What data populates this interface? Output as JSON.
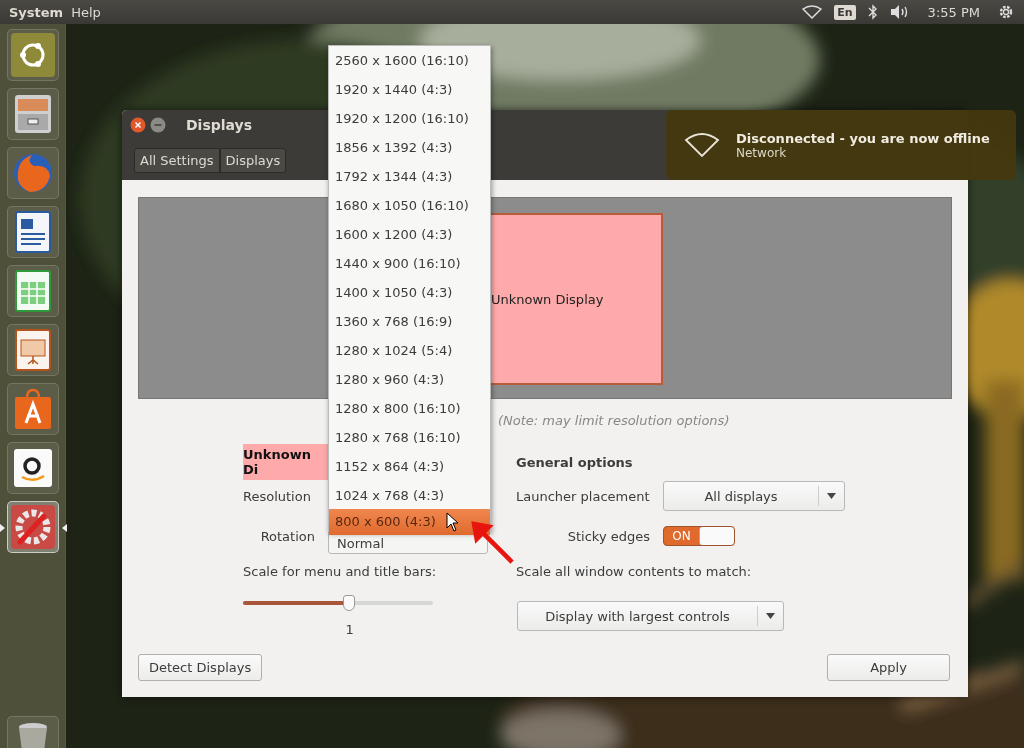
{
  "top_panel": {
    "menus": [
      "System",
      "Help"
    ],
    "keyboard_layout": "En",
    "clock": "3:55 PM"
  },
  "launcher": {
    "items": [
      {
        "kind": "dash",
        "active": false
      },
      {
        "kind": "files",
        "active": false
      },
      {
        "kind": "browser",
        "active": false
      },
      {
        "kind": "writer",
        "active": false
      },
      {
        "kind": "calc",
        "active": false
      },
      {
        "kind": "impress",
        "active": false
      },
      {
        "kind": "store",
        "active": false
      },
      {
        "kind": "amazon",
        "active": false
      },
      {
        "kind": "settings",
        "active": true
      },
      {
        "kind": "trash",
        "active": false
      }
    ]
  },
  "notification": {
    "title": "Disconnected - you are now offline",
    "subtitle": "Network"
  },
  "window": {
    "title": "Displays",
    "breadcrumbs": [
      "All Settings",
      "Displays"
    ],
    "monitor_label": "Unknown Display",
    "note": "(Note: may limit resolution options)",
    "display_name": "Unknown Di",
    "resolution_label": "Resolution",
    "rotation_label": "Rotation",
    "rotation_value": "Normal",
    "scale_label": "Scale for menu and title bars:",
    "scale": {
      "level": 0.56,
      "reading": "1"
    },
    "general": {
      "title": "General options",
      "launcher_label": "Launcher placement",
      "launcher_value": "All displays",
      "sticky_label": "Sticky edges",
      "sticky": {
        "on": true,
        "label": "ON"
      },
      "scale_all_label": "Scale all window contents to match:",
      "scale_all_value": "Display with largest controls"
    },
    "buttons": [
      "Detect Displays",
      "Apply"
    ]
  },
  "resolution_menu": {
    "items": [
      {
        "label": "2560 x 1600 (16:10)",
        "selected": false
      },
      {
        "label": "1920 x 1440 (4:3)",
        "selected": false
      },
      {
        "label": "1920 x 1200 (16:10)",
        "selected": false
      },
      {
        "label": "1856 x 1392 (4:3)",
        "selected": false
      },
      {
        "label": "1792 x 1344 (4:3)",
        "selected": false
      },
      {
        "label": "1680 x 1050 (16:10)",
        "selected": false
      },
      {
        "label": "1600 x 1200 (4:3)",
        "selected": false
      },
      {
        "label": "1440 x 900 (16:10)",
        "selected": false
      },
      {
        "label": "1400 x 1050 (4:3)",
        "selected": false
      },
      {
        "label": "1360 x 768 (16:9)",
        "selected": false
      },
      {
        "label": "1280 x 1024 (5:4)",
        "selected": false
      },
      {
        "label": "1280 x 960 (4:3)",
        "selected": false
      },
      {
        "label": "1280 x 800 (16:10)",
        "selected": false
      },
      {
        "label": "1280 x 768 (16:10)",
        "selected": false
      },
      {
        "label": "1152 x 864 (4:3)",
        "selected": false
      },
      {
        "label": "1024 x 768 (4:3)",
        "selected": false
      },
      {
        "label": "800 x 600 (4:3)",
        "selected": true
      }
    ]
  }
}
